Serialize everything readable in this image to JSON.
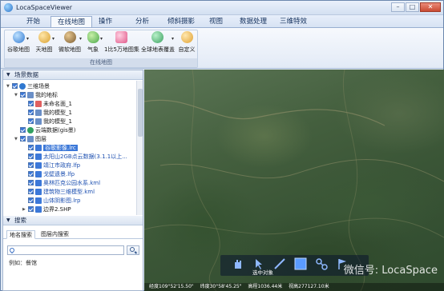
{
  "window": {
    "title": "LocaSpaceViewer"
  },
  "menu": [
    {
      "label": "开始"
    },
    {
      "label": "在线地图",
      "active": true
    },
    {
      "label": "操作"
    },
    {
      "label": "分析"
    },
    {
      "label": "倾斜摄影"
    },
    {
      "label": "视图"
    },
    {
      "label": "数据处理"
    },
    {
      "label": "三维特效"
    }
  ],
  "ribbon": {
    "group_caption": "在线地图",
    "buttons": [
      {
        "label": "谷歌地图",
        "icon": "globe-google-icon",
        "color": "#2f78d0"
      },
      {
        "label": "天地图",
        "icon": "tianditu-icon",
        "color": "#d9a030"
      },
      {
        "label": "微软地图",
        "icon": "microsoft-map-icon",
        "color": "#7a5a30"
      },
      {
        "label": "气象",
        "icon": "weather-icon",
        "color": "#4aa84a"
      },
      {
        "label": "1比5万地图集",
        "icon": "map-atlas-icon",
        "color": "#e05a8a"
      },
      {
        "label": "全球地表覆盖",
        "icon": "land-cover-icon",
        "color": "#3aa060"
      },
      {
        "label": "自定义",
        "icon": "custom-map-icon",
        "color": "#e0a030"
      }
    ]
  },
  "left_panel": {
    "scene_header": "场景数据",
    "tree": [
      {
        "label": "三维场景",
        "level": 0,
        "toggle": "▼",
        "icon": "globe-icon",
        "color": "#2f78d0"
      },
      {
        "label": "我的地标",
        "level": 1,
        "toggle": "▼",
        "icon": "folder-icon",
        "color": "#6a8fc7"
      },
      {
        "label": "未命名面_1",
        "level": 2,
        "toggle": "",
        "icon": "polygon-icon",
        "color": "#e06060"
      },
      {
        "label": "我的模型_1",
        "level": 2,
        "toggle": "",
        "icon": "model-icon",
        "color": "#6a8fc7"
      },
      {
        "label": "我的模型_1",
        "level": 2,
        "toggle": "",
        "icon": "model-icon",
        "color": "#6a8fc7"
      },
      {
        "label": "云端数据(gis墨)",
        "level": 1,
        "toggle": "",
        "icon": "cloud-icon",
        "color": "#30a060"
      },
      {
        "label": "图层",
        "level": 1,
        "toggle": "▼",
        "icon": "layers-icon",
        "color": "#6a8fc7"
      },
      {
        "label": "谷歌影像.lrc",
        "level": 2,
        "toggle": "",
        "icon": "image-layer-icon",
        "color": "#3c78d8",
        "selected": true
      },
      {
        "label": "太阳山2GB点云数据(3.1.1以上...",
        "level": 2,
        "toggle": "",
        "icon": "pointcloud-icon",
        "color": "#3c78d8",
        "link": true
      },
      {
        "label": "靖江市政府.lfp",
        "level": 2,
        "toggle": "",
        "icon": "lfp-icon",
        "color": "#3c78d8",
        "link": true
      },
      {
        "label": "戈壁遗景.lfp",
        "level": 2,
        "toggle": "",
        "icon": "lfp-icon",
        "color": "#3c78d8",
        "link": true
      },
      {
        "label": "奥林匹克公园水系.kml",
        "level": 2,
        "toggle": "",
        "icon": "kml-icon",
        "color": "#3c78d8",
        "link": true
      },
      {
        "label": "建筑物三维模型.kml",
        "level": 2,
        "toggle": "",
        "icon": "kml-icon",
        "color": "#3c78d8",
        "link": true
      },
      {
        "label": "山体阴影图.lrp",
        "level": 2,
        "toggle": "",
        "icon": "lrp-icon",
        "color": "#3c78d8",
        "link": true
      },
      {
        "label": "边界2.SHP",
        "level": 2,
        "toggle": "▶",
        "icon": "shp-icon",
        "color": "#3c78d8"
      }
    ],
    "search_header": "搜索",
    "search_tabs": [
      {
        "label": "地名搜索",
        "active": true
      },
      {
        "label": "图层内搜索",
        "active": false
      }
    ],
    "search_value": "",
    "example": "例如：餐馆"
  },
  "map": {
    "tool_caption": "选中对象",
    "tools": [
      {
        "icon": "hand-pan-icon"
      },
      {
        "icon": "pointer-icon"
      },
      {
        "icon": "line-icon"
      },
      {
        "icon": "rectangle-icon"
      },
      {
        "icon": "path-icon"
      },
      {
        "icon": "flag-icon"
      }
    ],
    "watermark": "微信号: LocaSpace",
    "status": {
      "longitude": "经度109°52'15.50\"",
      "latitude": "纬度30°58'45.25\"",
      "altitude": "高程1036.44米",
      "extra": "视高277127.10米"
    }
  }
}
